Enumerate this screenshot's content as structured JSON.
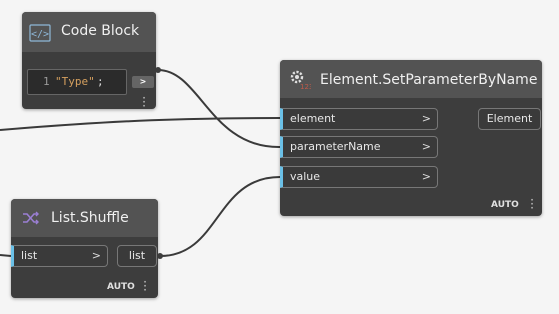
{
  "nodes": {
    "code_block": {
      "title": "Code Block",
      "icon": "code-brackets-icon",
      "line_number": "1",
      "code_string": "\"Type\"",
      "code_semicolon": ";",
      "output_chevron": ">"
    },
    "set_parameter": {
      "title": "Element.SetParameterByName",
      "icon": "gear-icon",
      "inputs": [
        {
          "label": "element",
          "chevron": ">"
        },
        {
          "label": "parameterName",
          "chevron": ">"
        },
        {
          "label": "value",
          "chevron": ">"
        }
      ],
      "output": {
        "label": "Element"
      },
      "lacing": "AUTO"
    },
    "list_shuffle": {
      "title": "List.Shuffle",
      "icon": "shuffle-icon",
      "inputs": [
        {
          "label": "list",
          "chevron": ">"
        }
      ],
      "output": {
        "label": "list"
      },
      "lacing": "AUTO"
    }
  },
  "colors": {
    "canvas": "#f5f5f5",
    "node_body": "#3d3d3d",
    "node_header": "#535353",
    "input_port_accent": "#6ac0e7",
    "wire": "#3a3a3a",
    "code_string": "#d5a05f",
    "shuffle_icon": "#9b7fd4"
  }
}
